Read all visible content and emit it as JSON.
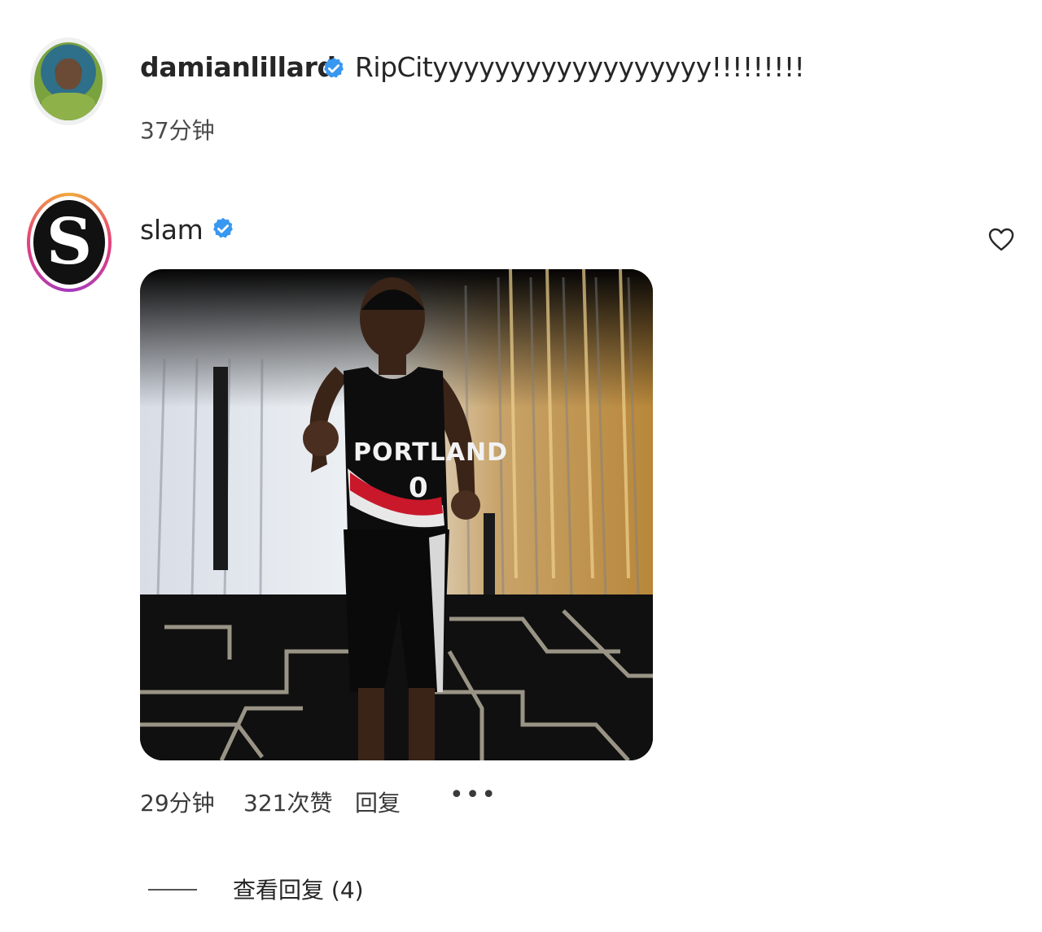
{
  "comments": [
    {
      "username": "damianlillard",
      "verified": true,
      "text": "RipCityyyyyyyyyyyyyyyyyy!!!!!!!!!",
      "time": "37分钟",
      "avatar_icon": "user-avatar-photo"
    },
    {
      "username": "slam",
      "verified": true,
      "avatar_letter": "S",
      "media": "image",
      "media_caption_visible": "PORTLAND 0",
      "time": "29分钟",
      "likes": "321次赞",
      "reply_label": "回复",
      "more_label": "•••",
      "like_icon": "heart-outline-icon",
      "view_replies": "查看回复 (4)"
    }
  ],
  "colors": {
    "verified_blue": "#3897f0",
    "text_primary": "#262626",
    "text_secondary": "#4a4a4a"
  }
}
